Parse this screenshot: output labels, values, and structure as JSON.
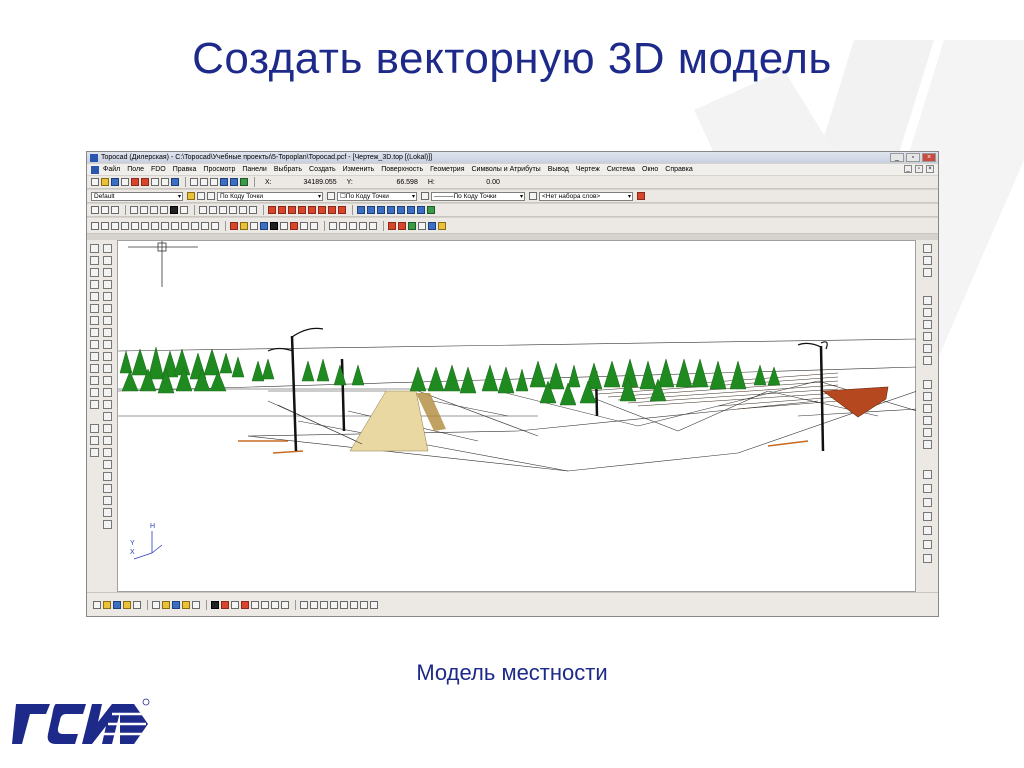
{
  "slide": {
    "title": "Создать векторную 3D модель",
    "caption": "Модель местности"
  },
  "app": {
    "window_title": "Topocad (Дилерская) - C:\\Topocad\\Учебные проекты\\5-Topoplan\\Topocad.pcf - [Чертеж_3D.top [(Lokal)]]",
    "menu": [
      "Файл",
      "Поле",
      "FDO",
      "Правка",
      "Просмотр",
      "Панели",
      "Выбрать",
      "Создать",
      "Изменить",
      "Поверхность",
      "Геометрия",
      "Символы и Атрибуты",
      "Вывод",
      "Чертеж",
      "Система",
      "Окно",
      "Справка"
    ],
    "toolbar": {
      "x_label": "X:",
      "x_value": "34189.055",
      "y_label": "Y:",
      "y_value": "66.598",
      "h_label": "H:",
      "h_value": "0.00",
      "layer_select": "Default",
      "point_code_select": "По Коду Точки",
      "color_select": "По Коду Точки",
      "line_select": "По Коду Точки",
      "wordset_select": "<Нет набора слов>"
    },
    "axis": {
      "h": "H",
      "y": "Y",
      "x": "X"
    }
  },
  "colors": {
    "title": "#1d2a8a",
    "tree": "#1f8a1f",
    "path": "#e9d8a2",
    "slab": "#b5481f"
  }
}
